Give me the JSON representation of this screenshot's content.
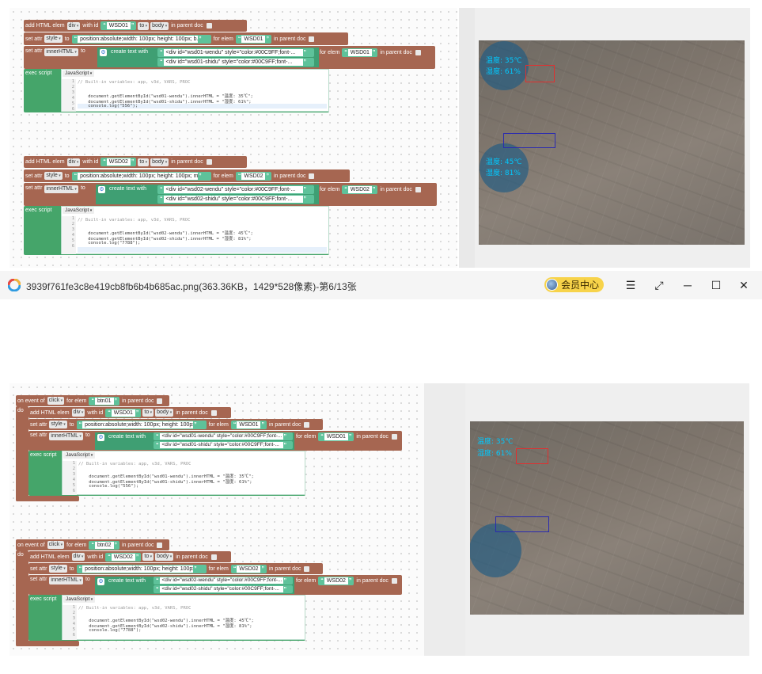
{
  "viewer": {
    "title": "3939f761fe3c8e419cb8fb6b4b685ac.png(363.36KB，1429*528像素)-第6/13张",
    "vip_label": "会员中心",
    "icons": [
      "menu-icon",
      "fullscreen-icon",
      "minimize-icon",
      "maximize-icon",
      "close-icon"
    ]
  },
  "blocks": {
    "add_html_elem": "add HTML elem",
    "div": "div",
    "with_id": "with id",
    "to": "to",
    "body": "body",
    "in_parent_doc": "in parent doc",
    "set_attr": "set attr",
    "style": "style",
    "innerHTML": "innerHTML",
    "for_elem": "for elem",
    "create_text_with": "create text with",
    "exec_script": "exec script",
    "javascript": "JavaScript",
    "on_event_of": "on event of",
    "click": "click",
    "do": "do"
  },
  "group1": {
    "id": "WSD01",
    "style_value": "position:absolute;width: 100px; height: 100px; b...",
    "line1": "<div id=\"wsd01-wendu\" style=\"color:#00C9FF;font-...",
    "line2": "<div id=\"wsd01-shidu\" style=\"color:#00C9FF;font-...",
    "code": [
      "// Built-in variables: app, v3d, VARS, PROC",
      "",
      "    document.getElementById(\"wsd01-wendu\").innerHTML = \"温度: 35℃\";",
      "    document.getElementById(\"wsd01-shidu\").innerHTML = \"湿度: 61%\";",
      "    console.log(\"556\");"
    ]
  },
  "group2": {
    "id": "WSD02",
    "style_value": "position:absolute;width: 100px; height: 100px; m...",
    "line1": "<div id=\"wsd02-wendu\" style=\"color:#00C9FF;font-...",
    "line2": "<div id=\"wsd02-shidu\" style=\"color:#00C9FF;font-...",
    "code": [
      "// Built-in variables: app, v3d, VARS, PROC",
      "",
      "    document.getElementById(\"wsd02-wendu\").innerHTML = \"温度: 45℃\";",
      "    document.getElementById(\"wsd02-shidu\").innerHTML = \"湿度: 81%\";",
      "    console.log(\"7788\");",
      ""
    ]
  },
  "events": {
    "btn1": "btn01",
    "btn2": "btn02"
  },
  "preview": {
    "wendu1": "温度: 35℃",
    "shidu1": "湿度: 61%",
    "wendu2": "温度: 45℃",
    "shidu2": "湿度: 81%"
  },
  "line_numbers": [
    "1",
    "2",
    "3",
    "4",
    "5",
    "6"
  ],
  "colors": {
    "block_brown": "#a66651",
    "block_green": "#3f9f73",
    "text_cyan": "#00c9ff",
    "box_red": "#e03030",
    "box_blue": "#2a2ab0"
  }
}
